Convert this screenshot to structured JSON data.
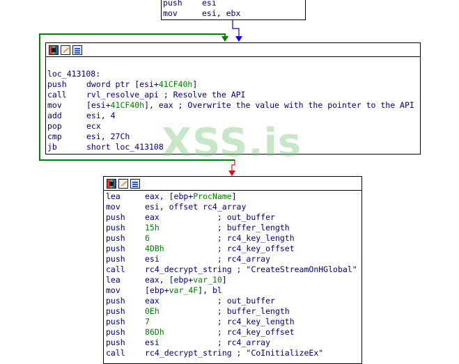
{
  "top_block": {
    "lines": [
      {
        "mn": "push",
        "ops": [
          {
            "t": "esi"
          }
        ]
      },
      {
        "mn": "mov",
        "ops": [
          {
            "t": "esi, ebx"
          }
        ]
      }
    ]
  },
  "middle_block": {
    "header_icons": [
      "grid-icon",
      "edit-icon",
      "graph-icon"
    ],
    "lines": [
      {
        "mn": "",
        "ops": []
      },
      {
        "mn": "loc_413108:",
        "ops": []
      },
      {
        "mn": "push",
        "ops": [
          {
            "t": "dword ptr [esi+"
          },
          {
            "t": "41CF40h",
            "c": "num"
          },
          {
            "t": "]"
          }
        ]
      },
      {
        "mn": "call",
        "ops": [
          {
            "t": "rvl_resolve_api ; Resolve the API"
          }
        ]
      },
      {
        "mn": "mov",
        "ops": [
          {
            "t": "[esi+"
          },
          {
            "t": "41CF40h",
            "c": "num"
          },
          {
            "t": "], eax ; Overwrite the value with the pointer to the API"
          }
        ]
      },
      {
        "mn": "add",
        "ops": [
          {
            "t": "esi, 4"
          }
        ]
      },
      {
        "mn": "pop",
        "ops": [
          {
            "t": "ecx"
          }
        ]
      },
      {
        "mn": "cmp",
        "ops": [
          {
            "t": "esi, 27Ch"
          }
        ]
      },
      {
        "mn": "jb",
        "ops": [
          {
            "t": "short loc_413108"
          }
        ]
      }
    ]
  },
  "bottom_block": {
    "header_icons": [
      "grid-icon",
      "edit-icon",
      "graph-icon"
    ],
    "lines": [
      {
        "mn": "lea",
        "ops": [
          {
            "t": "eax, [ebp+"
          },
          {
            "t": "ProcName",
            "c": "num"
          },
          {
            "t": "]"
          }
        ]
      },
      {
        "mn": "mov",
        "ops": [
          {
            "t": "esi, offset rc4_array"
          }
        ]
      },
      {
        "mn": "push",
        "ops": [
          {
            "t": "eax            ; out_buffer"
          }
        ]
      },
      {
        "mn": "push",
        "ops": [
          {
            "t": "15h",
            "c": "num"
          },
          {
            "t": "            ; buffer_length"
          }
        ]
      },
      {
        "mn": "push",
        "ops": [
          {
            "t": "6",
            "c": "num"
          },
          {
            "t": "              ; rc4_key_length"
          }
        ]
      },
      {
        "mn": "push",
        "ops": [
          {
            "t": "4DBh",
            "c": "num"
          },
          {
            "t": "           ; rc4_key_offset"
          }
        ]
      },
      {
        "mn": "push",
        "ops": [
          {
            "t": "esi            ; rc4_array"
          }
        ]
      },
      {
        "mn": "call",
        "ops": [
          {
            "t": "rc4_decrypt_string ; \"CreateStreamOnHGlobal\""
          }
        ]
      },
      {
        "mn": "lea",
        "ops": [
          {
            "t": "eax, [ebp+"
          },
          {
            "t": "var_10",
            "c": "num"
          },
          {
            "t": "]"
          }
        ]
      },
      {
        "mn": "mov",
        "ops": [
          {
            "t": "[ebp+"
          },
          {
            "t": "var_4F",
            "c": "num"
          },
          {
            "t": "], bl"
          }
        ]
      },
      {
        "mn": "push",
        "ops": [
          {
            "t": "eax            ; out_buffer"
          }
        ]
      },
      {
        "mn": "push",
        "ops": [
          {
            "t": "0Eh",
            "c": "num"
          },
          {
            "t": "            ; buffer_length"
          }
        ]
      },
      {
        "mn": "push",
        "ops": [
          {
            "t": "7",
            "c": "num"
          },
          {
            "t": "              ; rc4_key_length"
          }
        ]
      },
      {
        "mn": "push",
        "ops": [
          {
            "t": "86Dh",
            "c": "num"
          },
          {
            "t": "           ; rc4_key_offset"
          }
        ]
      },
      {
        "mn": "push",
        "ops": [
          {
            "t": "esi            ; rc4_array"
          }
        ]
      },
      {
        "mn": "call",
        "ops": [
          {
            "t": "rc4_decrypt_string ; \"CoInitializeEx\""
          }
        ]
      }
    ]
  },
  "watermark": {
    "text": "XSS.is"
  },
  "colors": {
    "text": "#000080",
    "number": "#008000",
    "loop_edge": "#008000",
    "false_edge": "#ff0000",
    "plain_edge": "#0000ff"
  }
}
